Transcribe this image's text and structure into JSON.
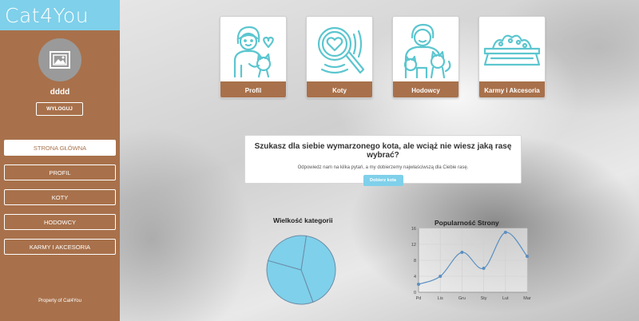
{
  "app": {
    "logo": "Cat4You"
  },
  "user": {
    "name": "dddd",
    "logout_label": "WYLOGUJ"
  },
  "nav": [
    {
      "label": "STRONA GŁÓWNA",
      "active": true
    },
    {
      "label": "PROFIL",
      "active": false
    },
    {
      "label": "KOTY",
      "active": false
    },
    {
      "label": "HODOWCY",
      "active": false
    },
    {
      "label": "KARMY I AKCESORIA",
      "active": false
    }
  ],
  "footer": "Property of Cat4You",
  "cards": [
    {
      "label": "Profil",
      "icon": "person-with-cat-icon"
    },
    {
      "label": "Koty",
      "icon": "magnifier-heart-icon"
    },
    {
      "label": "Hodowcy",
      "icon": "breeder-with-cats-icon"
    },
    {
      "label": "Karmy i Akcesoria",
      "icon": "food-bowl-icon"
    }
  ],
  "question": {
    "title": "Szukasz dla siebie wymarzonego kota, ale wciąż nie wiesz jaką rasę wybrać?",
    "subtitle": "Odpowiedz nam na kilka pytań, a my dobierzemy najwłaściwszą dla Ciebie rasę.",
    "button": "Dobierz kota"
  },
  "colors": {
    "accent": "#7fd0ea",
    "brown": "#a8714b",
    "chart_line": "#5a8fc0"
  },
  "chart_data": [
    {
      "type": "pie",
      "title": "Wielkość kategorii",
      "slices": [
        {
          "label": "",
          "value": 42
        },
        {
          "label": "",
          "value": 35
        },
        {
          "label": "",
          "value": 23
        }
      ]
    },
    {
      "type": "line",
      "title": "Popularność Strony",
      "categories": [
        "Pd",
        "Lis",
        "Gru",
        "Sty",
        "Lut",
        "Mar"
      ],
      "values": [
        2,
        4,
        10,
        6,
        15,
        9
      ],
      "ylim": [
        0,
        16
      ],
      "yticks": [
        0,
        4,
        8,
        12,
        16
      ],
      "grid": true
    }
  ]
}
